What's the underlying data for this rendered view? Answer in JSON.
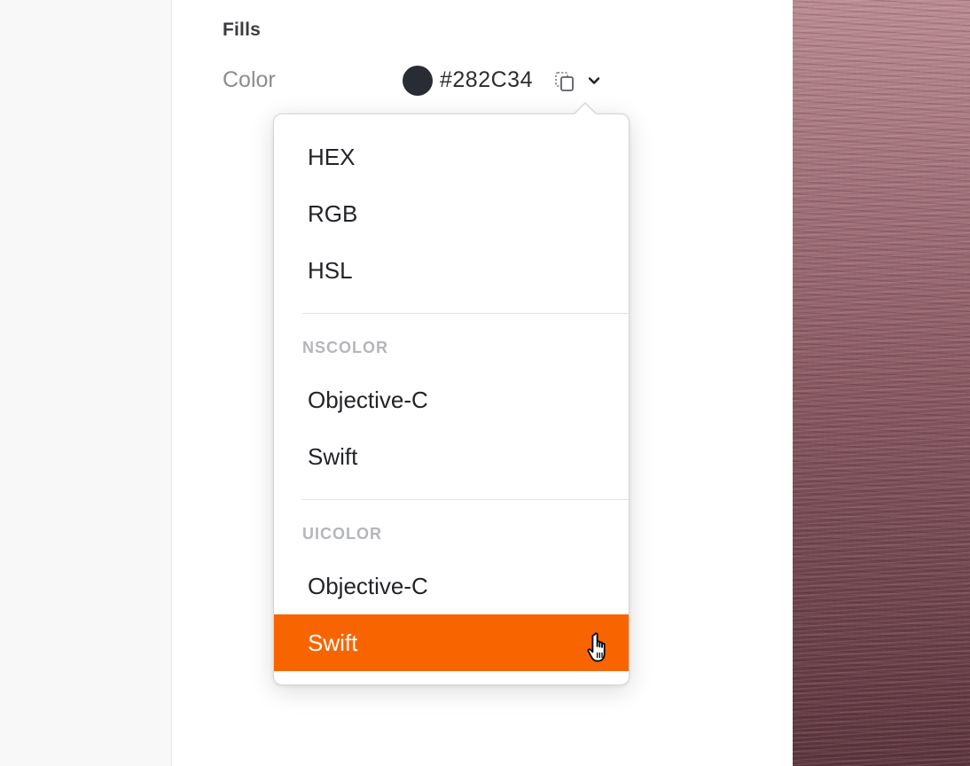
{
  "fills": {
    "title": "Fills",
    "color_label": "Color",
    "color_value": "#282C34",
    "swatch_color": "#282C34",
    "copy_icon": "copy-icon",
    "dropdown_icon": "chevron-down-icon"
  },
  "menu": {
    "items": [
      {
        "label": "HEX"
      },
      {
        "label": "RGB"
      },
      {
        "label": "HSL"
      }
    ],
    "groups": [
      {
        "header": "NSCOLOR",
        "items": [
          {
            "label": "Objective-C"
          },
          {
            "label": "Swift"
          }
        ]
      },
      {
        "header": "UICOLOR",
        "items": [
          {
            "label": "Objective-C"
          },
          {
            "label": "Swift",
            "highlighted": true
          }
        ]
      }
    ]
  },
  "colors": {
    "highlight": "#F86400",
    "text": "#222428",
    "muted_label": "#8A8C90",
    "group_header": "#B4B6BA"
  }
}
